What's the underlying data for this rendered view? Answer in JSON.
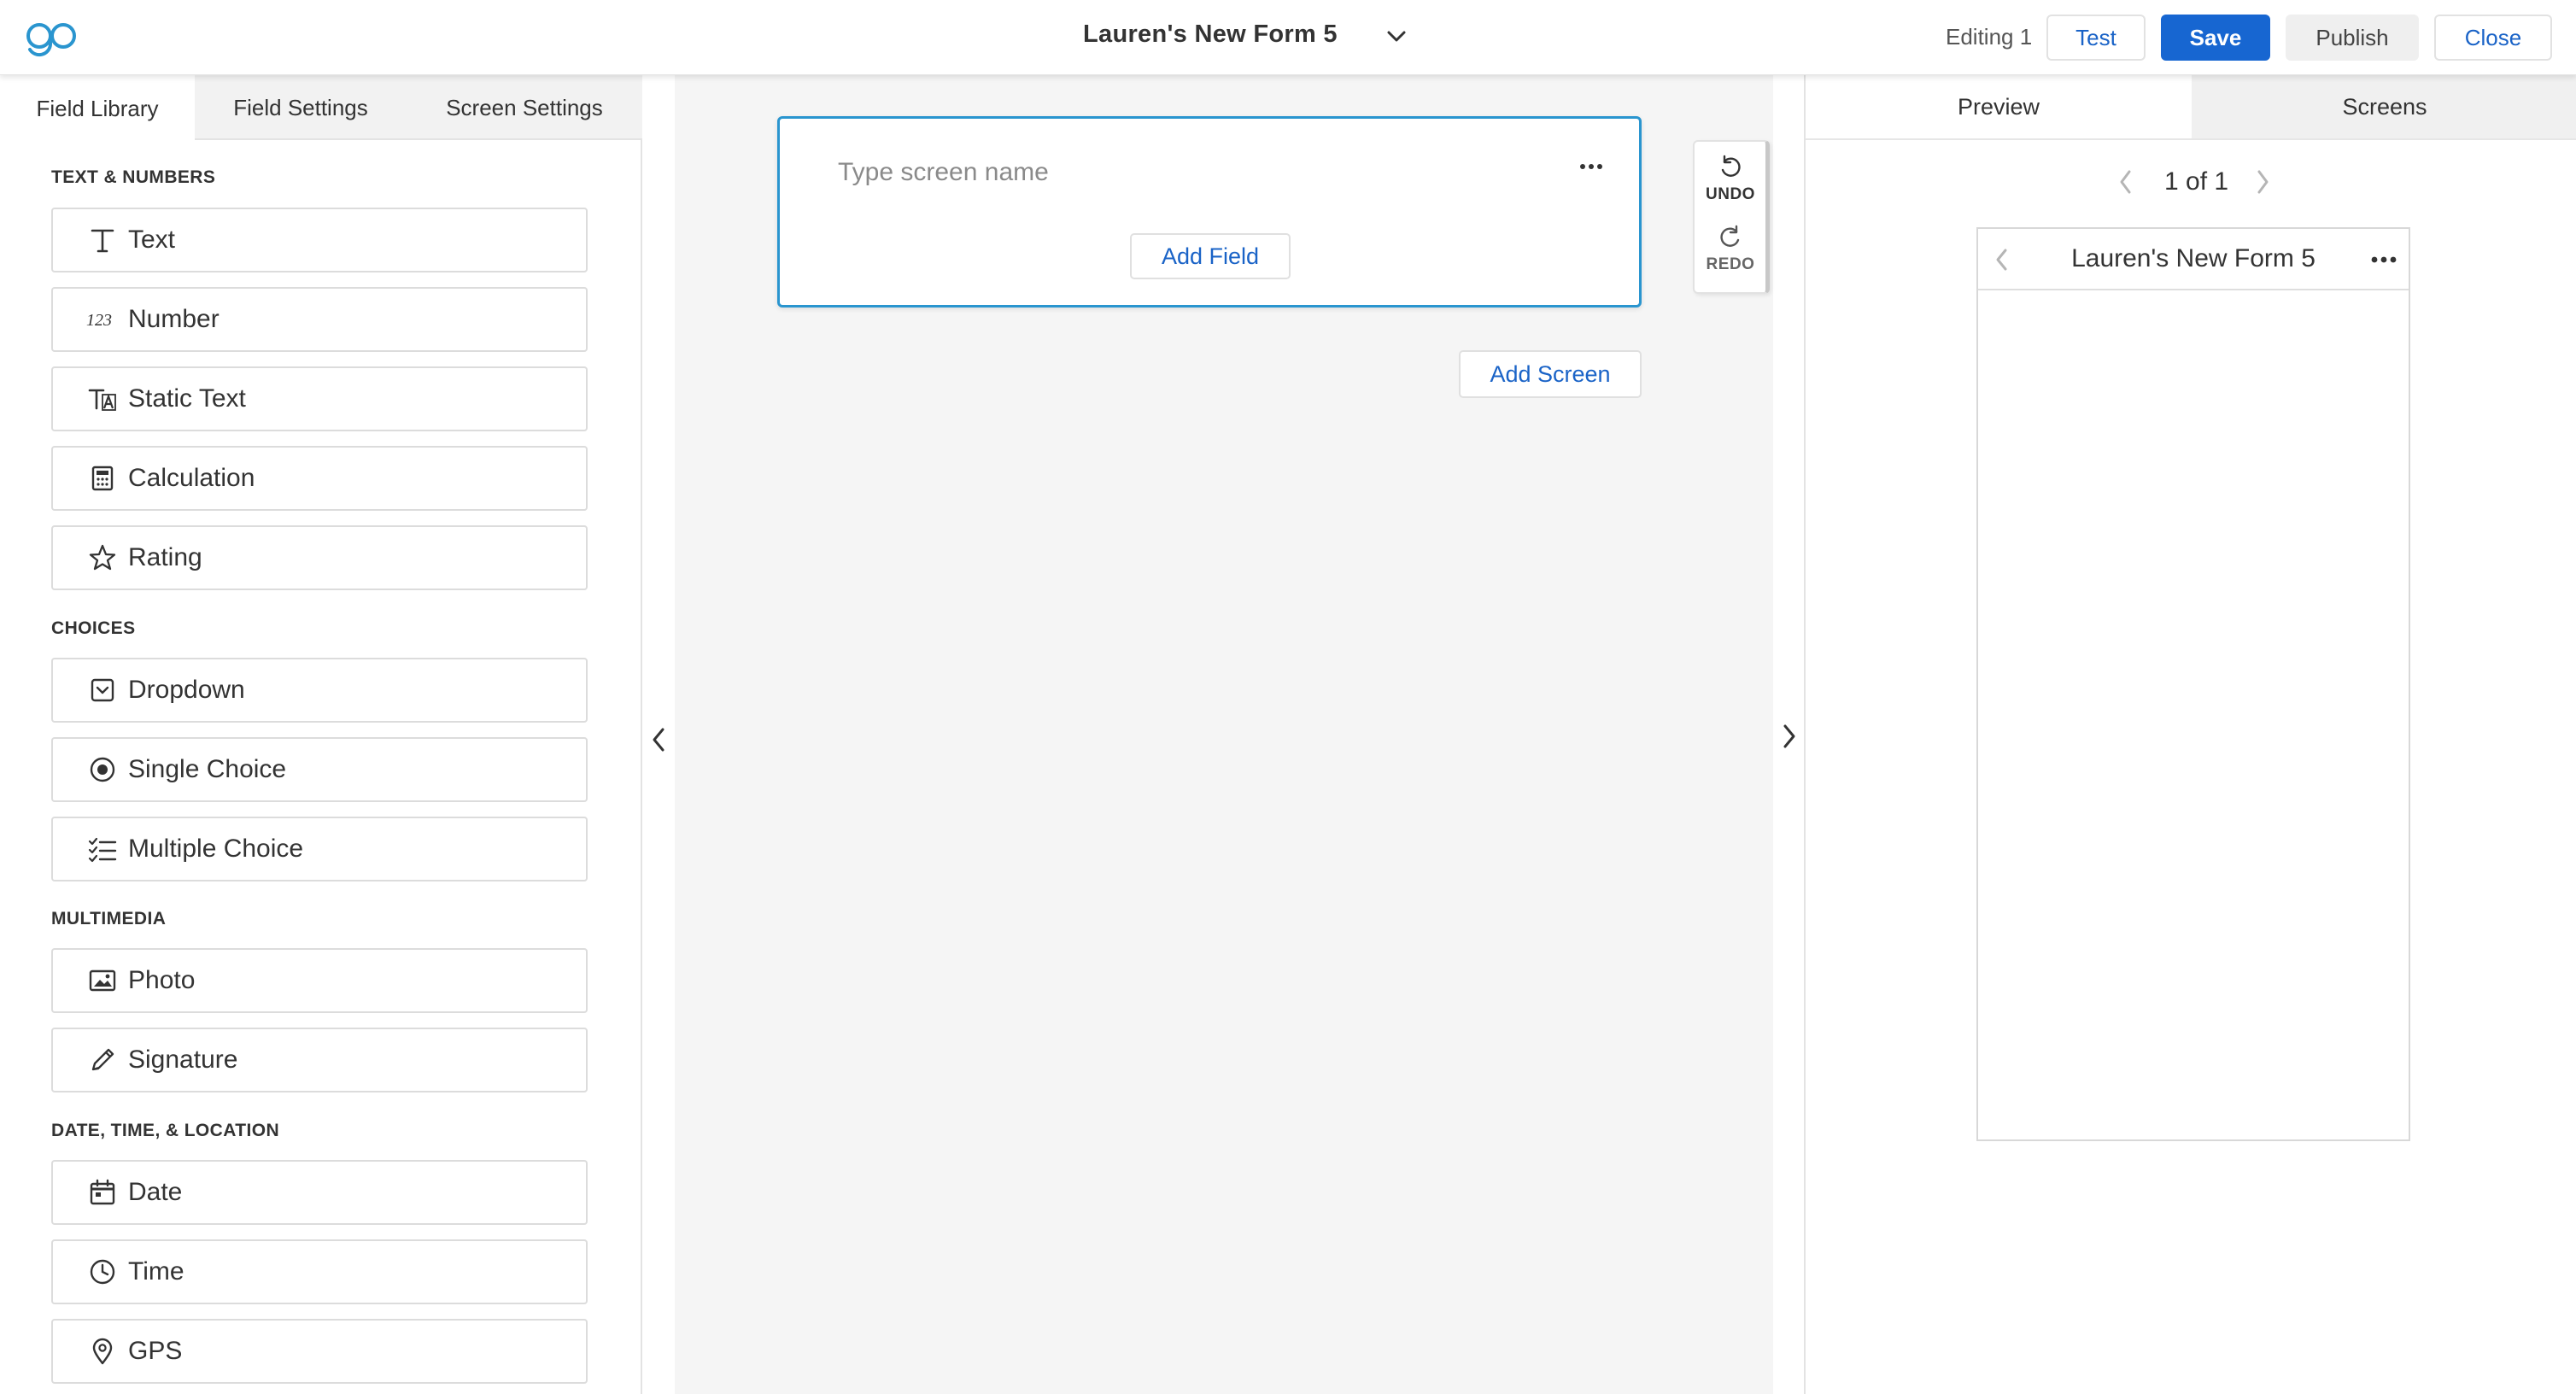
{
  "app": {
    "logo_icon": "go-logo-icon"
  },
  "header": {
    "form_title": "Lauren's New Form 5",
    "editing_status": "Editing 1",
    "test_label": "Test",
    "save_label": "Save",
    "publish_label": "Publish",
    "close_label": "Close"
  },
  "colors": {
    "accent": "#1766d1",
    "link": "#1a63c7",
    "selected_border": "#2a95cf"
  },
  "left_panel": {
    "tabs": [
      {
        "label": "Field Library",
        "active": true
      },
      {
        "label": "Field Settings",
        "active": false
      },
      {
        "label": "Screen Settings",
        "active": false
      }
    ],
    "sections": [
      {
        "heading": "TEXT & NUMBERS",
        "fields": [
          {
            "label": "Text",
            "icon": "text-icon"
          },
          {
            "label": "Number",
            "icon": "number-icon"
          },
          {
            "label": "Static Text",
            "icon": "static-text-icon"
          },
          {
            "label": "Calculation",
            "icon": "calculator-icon"
          },
          {
            "label": "Rating",
            "icon": "star-icon"
          }
        ]
      },
      {
        "heading": "CHOICES",
        "fields": [
          {
            "label": "Dropdown",
            "icon": "dropdown-icon"
          },
          {
            "label": "Single Choice",
            "icon": "radio-icon"
          },
          {
            "label": "Multiple Choice",
            "icon": "checklist-icon"
          }
        ]
      },
      {
        "heading": "MULTIMEDIA",
        "fields": [
          {
            "label": "Photo",
            "icon": "photo-icon"
          },
          {
            "label": "Signature",
            "icon": "pen-icon"
          }
        ]
      },
      {
        "heading": "DATE, TIME, & LOCATION",
        "fields": [
          {
            "label": "Date",
            "icon": "calendar-icon"
          },
          {
            "label": "Time",
            "icon": "clock-icon"
          },
          {
            "label": "GPS",
            "icon": "location-pin-icon"
          }
        ]
      }
    ]
  },
  "canvas": {
    "screen_name_placeholder": "Type screen name",
    "add_field_label": "Add Field",
    "add_screen_label": "Add Screen",
    "undo_label": "UNDO",
    "redo_label": "REDO"
  },
  "right_panel": {
    "tabs": [
      {
        "label": "Preview",
        "active": true
      },
      {
        "label": "Screens",
        "active": false
      }
    ],
    "pager_text": "1 of 1",
    "phone_title": "Lauren's New Form 5"
  }
}
